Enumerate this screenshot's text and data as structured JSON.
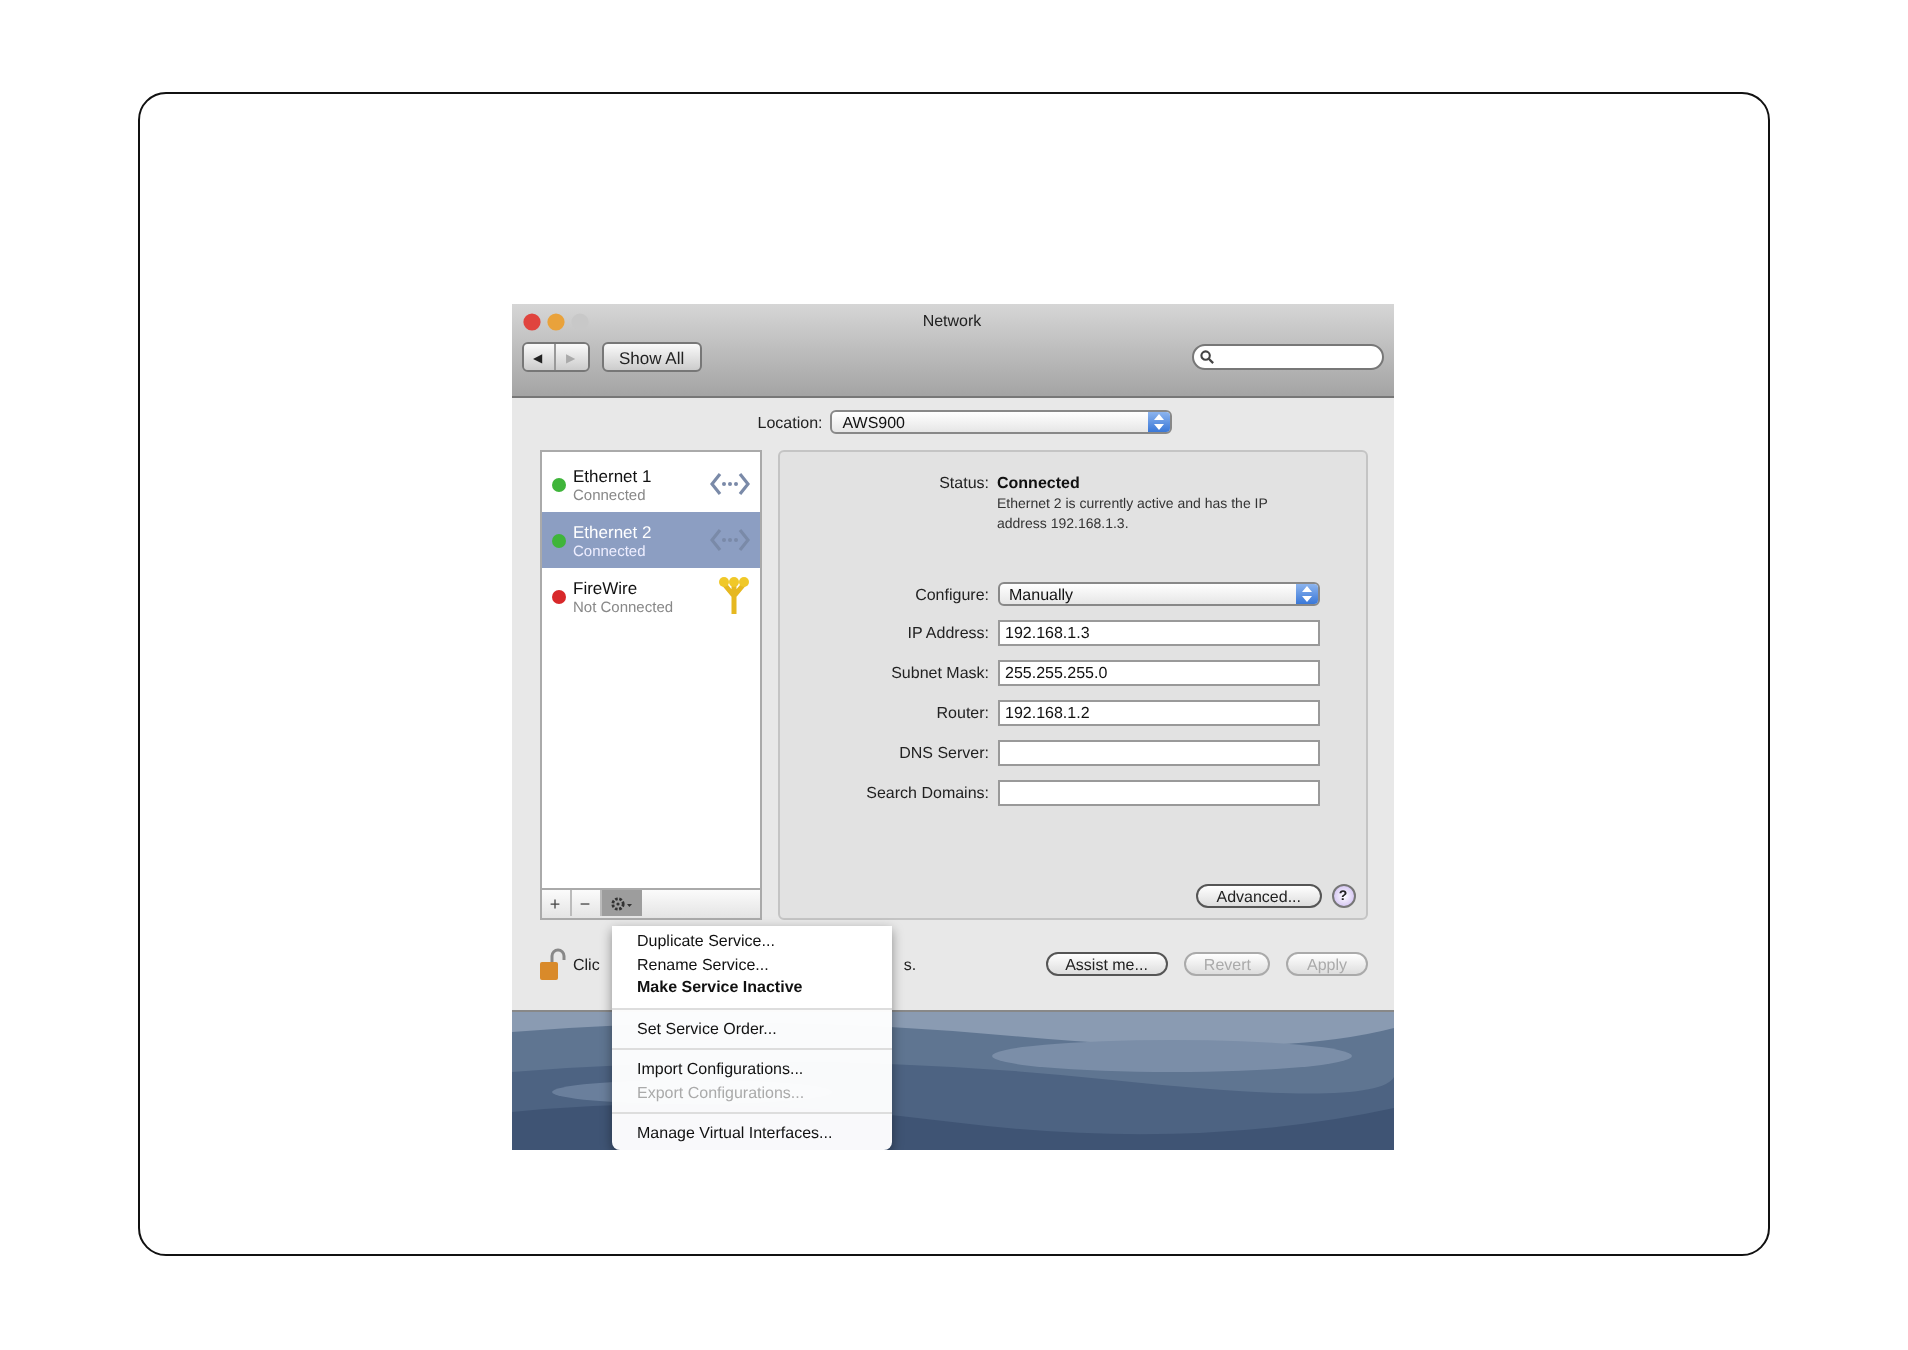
{
  "window": {
    "title": "Network"
  },
  "toolbar": {
    "nav": [
      {
        "glyph": "◀",
        "disabled": false
      },
      {
        "glyph": "▶",
        "disabled": true
      }
    ],
    "show_all": "Show All"
  },
  "location": {
    "label": "Location:",
    "value": "AWS900"
  },
  "services": [
    {
      "name": "Ethernet 1",
      "status": "Connected",
      "color": "#3fb53a",
      "kind": "ethernet",
      "selected": false
    },
    {
      "name": "Ethernet 2",
      "status": "Connected",
      "color": "#3fb53a",
      "kind": "ethernet",
      "selected": true
    },
    {
      "name": "FireWire",
      "status": "Not Connected",
      "color": "#d8282a",
      "kind": "firewire",
      "selected": false
    }
  ],
  "list_buttons": [
    "+",
    "−"
  ],
  "detail": {
    "status_label": "Status:",
    "status_value": "Connected",
    "status_text": "Ethernet 2 is currently active and has the IP address 192.168.1.3.",
    "fields": [
      {
        "label": "Configure:",
        "kind": "popup",
        "value": "Manually"
      },
      {
        "label": "IP Address:",
        "kind": "text",
        "value": "192.168.1.3"
      },
      {
        "label": "Subnet Mask:",
        "kind": "text",
        "value": "255.255.255.0"
      },
      {
        "label": "Router:",
        "kind": "text",
        "value": "192.168.1.2"
      },
      {
        "label": "DNS Server:",
        "kind": "text"
      },
      {
        "label": "Search Domains:",
        "kind": "text"
      }
    ],
    "advanced": "Advanced...",
    "help": "?"
  },
  "footer": {
    "lock_text": [
      "Clic",
      "s."
    ],
    "buttons": [
      {
        "label": "Assist me...",
        "disabled": false
      },
      {
        "label": "Revert",
        "disabled": true
      },
      {
        "label": "Apply",
        "disabled": true
      }
    ]
  },
  "action_menu": [
    {
      "kind": "item",
      "label": "Duplicate Service...",
      "bold": false,
      "disabled": false
    },
    {
      "kind": "item",
      "label": "Rename Service...",
      "bold": false,
      "disabled": false
    },
    {
      "kind": "item",
      "label": "Make Service Inactive",
      "bold": true,
      "disabled": false
    },
    {
      "kind": "separator"
    },
    {
      "kind": "item",
      "label": "Set Service Order...",
      "bold": false,
      "disabled": false
    },
    {
      "kind": "separator"
    },
    {
      "kind": "item",
      "label": "Import Configurations...",
      "bold": false,
      "disabled": false
    },
    {
      "kind": "item",
      "label": "Export Configurations...",
      "bold": false,
      "disabled": true
    },
    {
      "kind": "separator"
    },
    {
      "kind": "item",
      "label": "Manage Virtual Interfaces...",
      "bold": false,
      "disabled": false
    }
  ]
}
